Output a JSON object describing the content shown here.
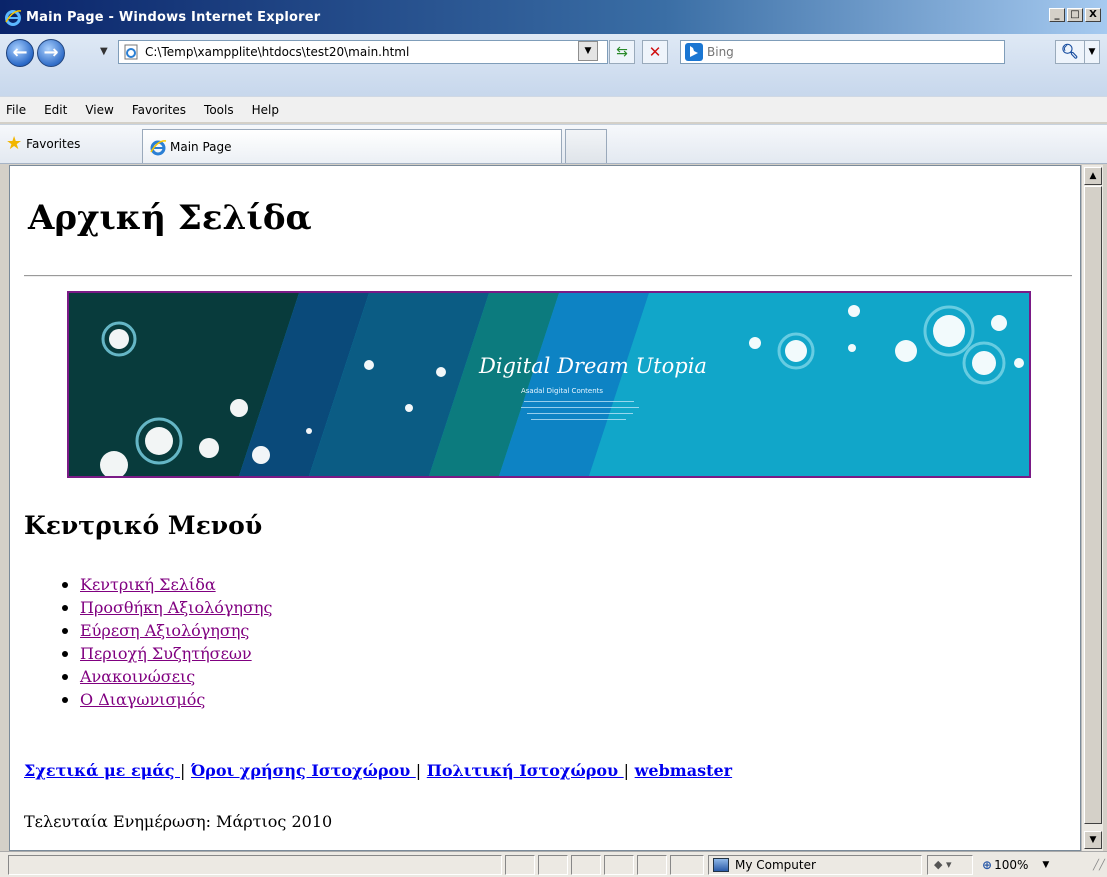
{
  "window": {
    "title": "Main Page - Windows Internet Explorer",
    "minimize": "_",
    "maximize": "□",
    "close": "X"
  },
  "toolbar": {
    "address": "C:\\Temp\\xampplite\\htdocs\\test20\\main.html",
    "search_placeholder": "Bing"
  },
  "menu": [
    "File",
    "Edit",
    "View",
    "Favorites",
    "Tools",
    "Help"
  ],
  "favorites": {
    "label": "Favorites",
    "tab_title": "Main Page"
  },
  "page": {
    "heading": "Αρχική Σελίδα",
    "banner": {
      "title": "Digital Dream Utopia",
      "subtitle": "Asadal Digital Contents"
    },
    "menu_heading": "Κεντρικό Μενού",
    "menu_items": [
      "Κεντρική Σελίδα",
      "Προσθήκη Αξιολόγησης",
      "Εύρεση Αξιολόγησης",
      "Περιοχή Συζητήσεων",
      "Ανακοινώσεις",
      "Ο Διαγωνισμός"
    ],
    "footer_links": [
      "Σχετικά με εμάς ",
      "Όροι χρήσης Ιστοχώρου ",
      "Πολιτική Ιστοχώρου ",
      "webmaster"
    ],
    "separator": "|",
    "last_update": "Τελευταία Ενημέρωση: Μάρτιος 2010"
  },
  "status": {
    "zone": "My Computer",
    "zoom": "100%"
  }
}
